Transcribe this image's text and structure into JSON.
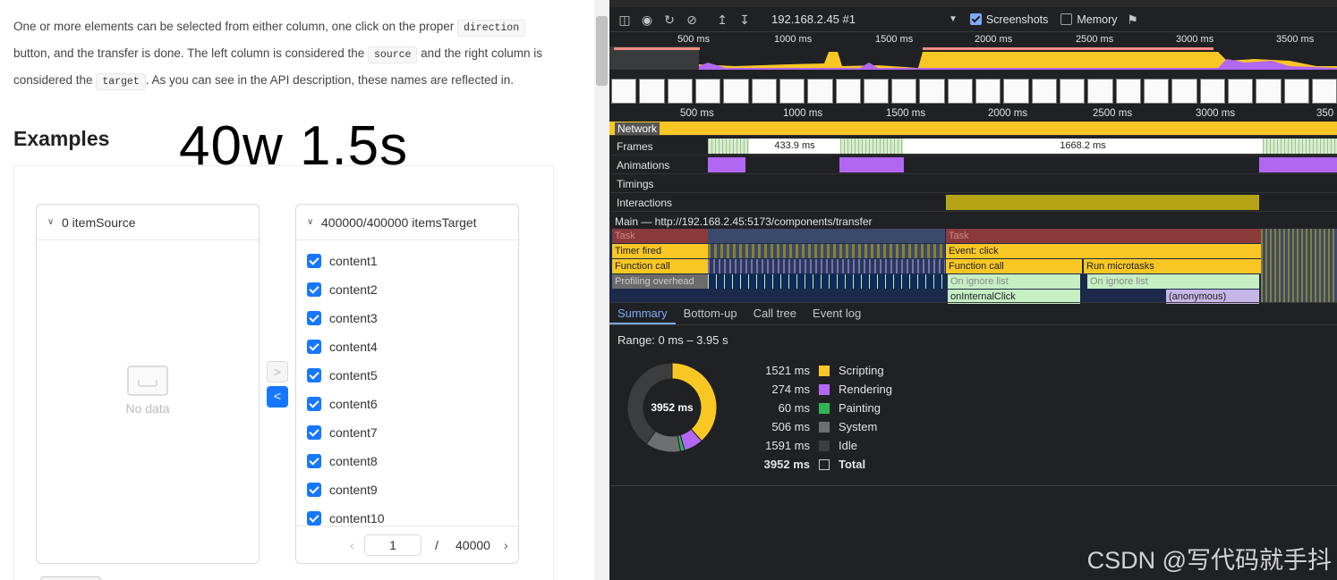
{
  "doc": {
    "p1": "One or more elements can be selected from either column, one click on the proper ",
    "c1": "direction",
    "p2": " button, and the transfer is done. The left column is considered the ",
    "c2": "source",
    "p3": " and the right column is considered the ",
    "c3": "target",
    "p4": ". As you can see in the API description, these names are reflected in.",
    "examples_title": "Examples",
    "overlay_text": "40w 1.5s"
  },
  "transfer": {
    "source_header": "0 itemSource",
    "empty_text": "No data",
    "target_header": "400000/400000 itemsTarget",
    "items": [
      "content1",
      "content2",
      "content3",
      "content4",
      "content5",
      "content6",
      "content7",
      "content8",
      "content9",
      "content10"
    ],
    "page_current": "1",
    "page_sep": "/",
    "page_total": "40000",
    "btn_right": ">",
    "btn_left": "<"
  },
  "devtools": {
    "target": "192.168.2.45 #1",
    "screenshots_label": "Screenshots",
    "memory_label": "Memory",
    "overview_ticks": [
      "500 ms",
      "1000 ms",
      "1500 ms",
      "2000 ms",
      "2500 ms",
      "3000 ms",
      "3500 ms"
    ],
    "ruler_ticks": [
      "500 ms",
      "1000 ms",
      "1500 ms",
      "2000 ms",
      "2500 ms",
      "3000 ms",
      "350"
    ],
    "tracks": {
      "network": "Network",
      "frames": "Frames",
      "frame_a": "433.9 ms",
      "frame_b": "1668.2 ms",
      "animations": "Animations",
      "timings": "Timings",
      "interactions": "Interactions",
      "main": "Main — http://192.168.2.45:5173/components/transfer"
    },
    "flame": {
      "task1": "Task",
      "task2": "Task",
      "timer": "Timer fired",
      "event": "Event: click",
      "func1": "Function call",
      "func2": "Function call",
      "micro": "Run microtasks",
      "overhead": "Profiling overhead",
      "ignore1": "On ignore list",
      "ignore2": "On ignore list",
      "internal": "onInternalClick",
      "anon": "(anonymous)"
    },
    "tabs": [
      "Summary",
      "Bottom-up",
      "Call tree",
      "Event log"
    ],
    "range": "Range: 0 ms – 3.95 s",
    "total_center": "3952 ms",
    "legend": [
      {
        "value": "1521 ms",
        "label": "Scripting",
        "color": "#f9c724"
      },
      {
        "value": "274 ms",
        "label": "Rendering",
        "color": "#b267f3"
      },
      {
        "value": "60 ms",
        "label": "Painting",
        "color": "#31b454"
      },
      {
        "value": "506 ms",
        "label": "System",
        "color": "#6e6f70"
      },
      {
        "value": "1591 ms",
        "label": "Idle",
        "color": "#3c3d3f"
      },
      {
        "value": "3952 ms",
        "label": "Total",
        "color": "transparent"
      }
    ]
  },
  "watermark": "CSDN @写代码就手抖"
}
